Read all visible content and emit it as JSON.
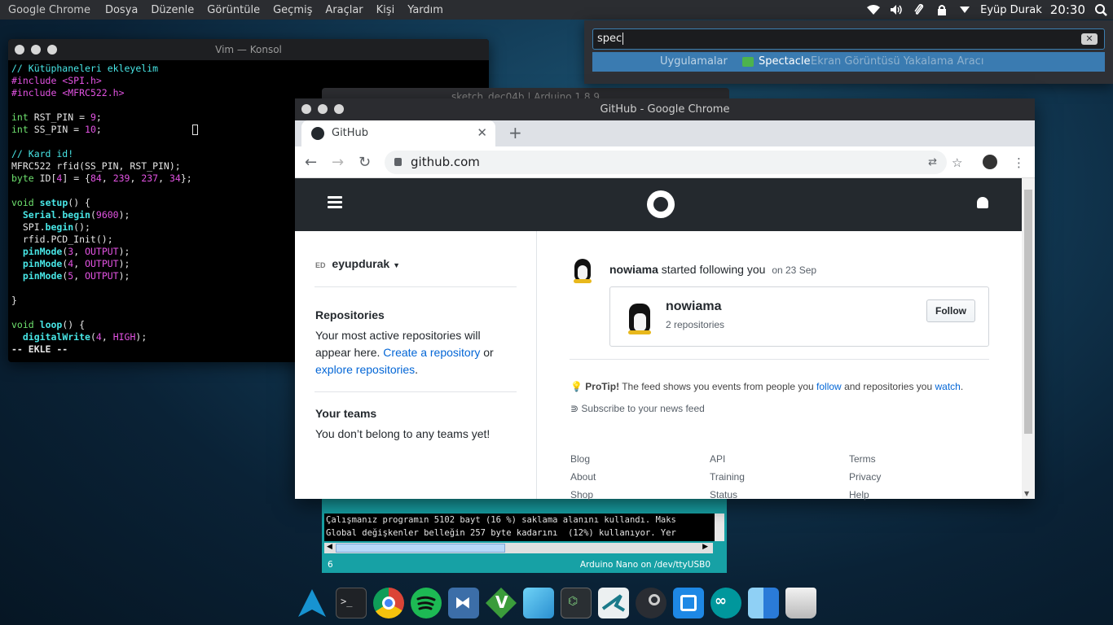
{
  "menubar": {
    "app": "Google Chrome",
    "items": [
      "Dosya",
      "Düzenle",
      "Görüntüle",
      "Geçmiş",
      "Araçlar",
      "Kişi",
      "Yardım"
    ],
    "user": "Eyüp Durak",
    "clock": "20:30"
  },
  "vim": {
    "title": "Vim — Konsol",
    "status": "-- EKLE --"
  },
  "arduino": {
    "title": "sketch_dec04b | Arduino 1.8.9",
    "console_lines": [
      "Çalışmanız programın 5102 bayt (16 %) saklama alanını kullandı. Maks",
      "Global değişkenler belleğin 257 byte kadarını  (12%) kullanıyor. Yer"
    ],
    "line_no": "6",
    "board": "Arduino Nano on /dev/ttyUSB0"
  },
  "launcher": {
    "query": "spec",
    "category": "Uygulamalar",
    "result_name": "Spectacle",
    "result_desc": "Ekran Görüntüsü Yakalama Aracı"
  },
  "chrome": {
    "title": "GitHub - Google Chrome",
    "tab_label": "GitHub",
    "url": "github.com"
  },
  "github": {
    "username": "eyupdurak",
    "repos_heading": "Repositories",
    "repos_text_a": "Your most active repositories will appear here.",
    "repos_link_create": "Create a repository",
    "repos_or": "or",
    "repos_link_explore": "explore repositories",
    "teams_heading": "Your teams",
    "teams_text": "You don’t belong to any teams yet!",
    "feed_user": "nowiama",
    "feed_action": "started following you",
    "feed_date": "on 23 Sep",
    "card_name": "nowiama",
    "card_repos": "2 repositories",
    "follow_label": "Follow",
    "protip_label": "ProTip!",
    "protip_text_a": "The feed shows you events from people you",
    "protip_link_follow": "follow",
    "protip_text_b": "and repositories you",
    "protip_link_watch": "watch",
    "subscribe": "Subscribe to your news feed",
    "footer": [
      [
        "Blog",
        "About",
        "Shop"
      ],
      [
        "API",
        "Training",
        "Status"
      ],
      [
        "Terms",
        "Privacy",
        "Help"
      ]
    ]
  },
  "dock": {
    "icons": [
      "arch-launcher-icon",
      "terminal-icon",
      "chrome-icon",
      "spotify-icon",
      "vscode-icon",
      "vim-icon",
      "virtualbox-icon",
      "code-editor-icon",
      "terminal-app-icon",
      "steam-icon",
      "virtualbox-manager-icon",
      "arduino-icon",
      "finder-icon",
      "trash-icon"
    ]
  }
}
